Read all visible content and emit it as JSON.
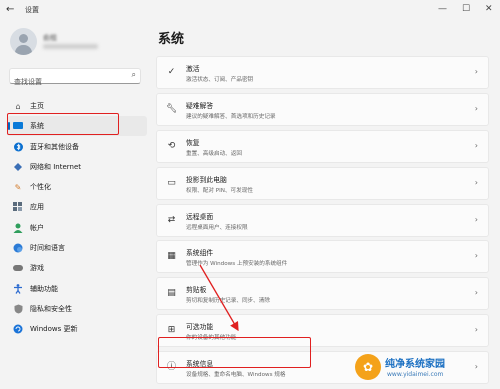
{
  "window": {
    "title": "设置",
    "back_icon": "back-arrow-icon",
    "min": "—",
    "max": "☐",
    "close": "✕"
  },
  "user": {
    "name": "俞桂"
  },
  "search": {
    "placeholder": "查找设置"
  },
  "nav": [
    {
      "label": "主页",
      "icon": "home-icon",
      "color": "#555555"
    },
    {
      "label": "系统",
      "icon": "monitor-icon",
      "color": "#0a7ad8"
    },
    {
      "label": "蓝牙和其他设备",
      "icon": "bluetooth-icon",
      "color": "#0a6fd0"
    },
    {
      "label": "网络和 Internet",
      "icon": "network-icon",
      "color": "#3b6fb6"
    },
    {
      "label": "个性化",
      "icon": "brush-icon",
      "color": "#d27b2c"
    },
    {
      "label": "应用",
      "icon": "apps-icon",
      "color": "#5a6b7c"
    },
    {
      "label": "帐户",
      "icon": "account-icon",
      "color": "#2f9e5c"
    },
    {
      "label": "时间和语言",
      "icon": "globe-clock-icon",
      "color": "#2b7bd6"
    },
    {
      "label": "游戏",
      "icon": "game-icon",
      "color": "#777777"
    },
    {
      "label": "辅助功能",
      "icon": "accessibility-icon",
      "color": "#2a6ad0"
    },
    {
      "label": "隐私和安全性",
      "icon": "shield-icon",
      "color": "#777777"
    },
    {
      "label": "Windows 更新",
      "icon": "windows-update-icon",
      "color": "#1a73d8"
    }
  ],
  "page": {
    "title": "系统"
  },
  "cards": [
    {
      "title": "激活",
      "subtitle": "激活状态、订阅、产品密钥",
      "icon": "check-circle-icon"
    },
    {
      "title": "疑难解答",
      "subtitle": "建议的疑难解答、首选项和历史记录",
      "icon": "wrench-icon"
    },
    {
      "title": "恢复",
      "subtitle": "重置、高级启动、返回",
      "icon": "recovery-icon"
    },
    {
      "title": "投影到此电脑",
      "subtitle": "权限、配对 PIN、可发现性",
      "icon": "projection-icon"
    },
    {
      "title": "远程桌面",
      "subtitle": "远程桌面用户、连接权限",
      "icon": "remote-desktop-icon"
    },
    {
      "title": "系统组件",
      "subtitle": "管理作为 Windows 上预安装的系统组件",
      "icon": "components-icon"
    },
    {
      "title": "剪贴板",
      "subtitle": "剪切和复制历史记录、同步、清除",
      "icon": "clipboard-icon"
    },
    {
      "title": "可选功能",
      "subtitle": "你的设备的其他功能",
      "icon": "optional-features-icon"
    },
    {
      "title": "系统信息",
      "subtitle": "设备规格、重命名电脑、Windows 规格",
      "icon": "info-icon"
    }
  ],
  "watermark": {
    "text": "纯净系统家园",
    "url": "www.yidaimei.com",
    "logo_glyph": "✿"
  },
  "accent": "#0067c0",
  "highlight_color": "#e02020"
}
